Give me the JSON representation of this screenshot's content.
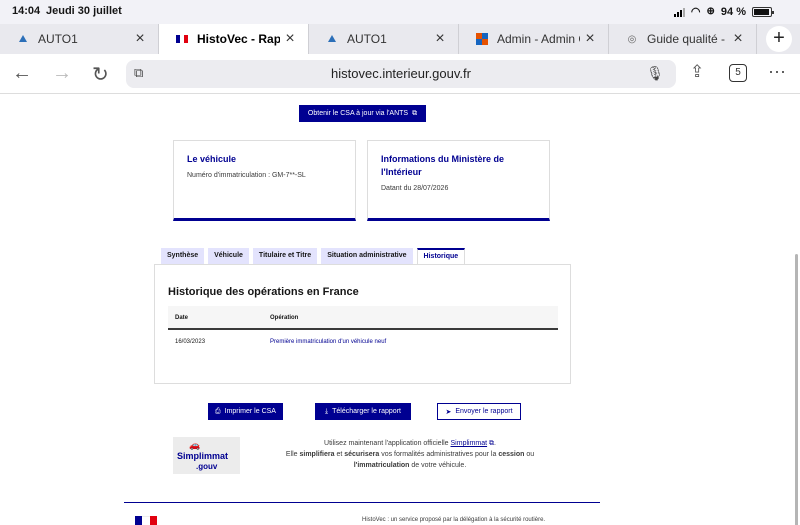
{
  "status": {
    "time": "14:04",
    "date": "Jeudi 30 juillet",
    "battery": "94 %",
    "battery_level": 0.94
  },
  "tabs": [
    {
      "label": "AUTO1",
      "icon": "auto1-favicon",
      "active": false
    },
    {
      "label": "HistoVec - Rapport d",
      "icon": "french-flag-favicon",
      "active": true
    },
    {
      "label": "AUTO1",
      "icon": "auto1-favicon",
      "active": false
    },
    {
      "label": "Admin - Admin Cent",
      "icon": "admin-favicon",
      "active": false
    },
    {
      "label": "Guide qualité - Com",
      "icon": "globe-favicon",
      "active": false
    }
  ],
  "toolbar": {
    "url": "histovec.interieur.gouv.fr",
    "tab_count": "5"
  },
  "page": {
    "csa_top_button": "Obtenir le CSA à jour via l'ANTS",
    "card_vehicle": {
      "title": "Le véhicule",
      "text": "Numéro d'immatriculation : GM-7**-SL"
    },
    "card_ministry": {
      "title": "Informations du Ministère de l'Intérieur",
      "text": "Datant du 28/07/2026"
    },
    "subtabs": [
      "Synthèse",
      "Véhicule",
      "Titulaire et Titre",
      "Situation administrative",
      "Historique"
    ],
    "active_subtab": "Historique",
    "history": {
      "title": "Historique des opérations en France",
      "col_date": "Date",
      "col_operation": "Opération",
      "rows": [
        {
          "date": "16/03/2023",
          "operation": "Première immatriculation d'un véhicule neuf"
        }
      ]
    },
    "actions": {
      "print": "Imprimer le CSA",
      "download": "Télécharger le rapport",
      "send": "Envoyer le rapport"
    },
    "promo": {
      "logo_line1": "Simplimmat",
      "logo_line2": ".gouv",
      "text_before": "Utilisez maintenant l'application officielle ",
      "link": "Simplimmat",
      "text_l2a": "Elle ",
      "strong1": "simplifiera",
      "text_l2b": " et ",
      "strong2": "sécurisera",
      "text_l2c": " vos formalités administratives pour la ",
      "strong3": "cession",
      "text_l2d": " ou",
      "strong4": "l'immatriculation",
      "text_l3": " de votre véhicule."
    },
    "footer": {
      "text": "HistoVec : un service proposé par la délégation à la sécurité routière."
    }
  },
  "colors": {
    "brand": "#000091",
    "tab_bg": "#e3e3fd"
  }
}
